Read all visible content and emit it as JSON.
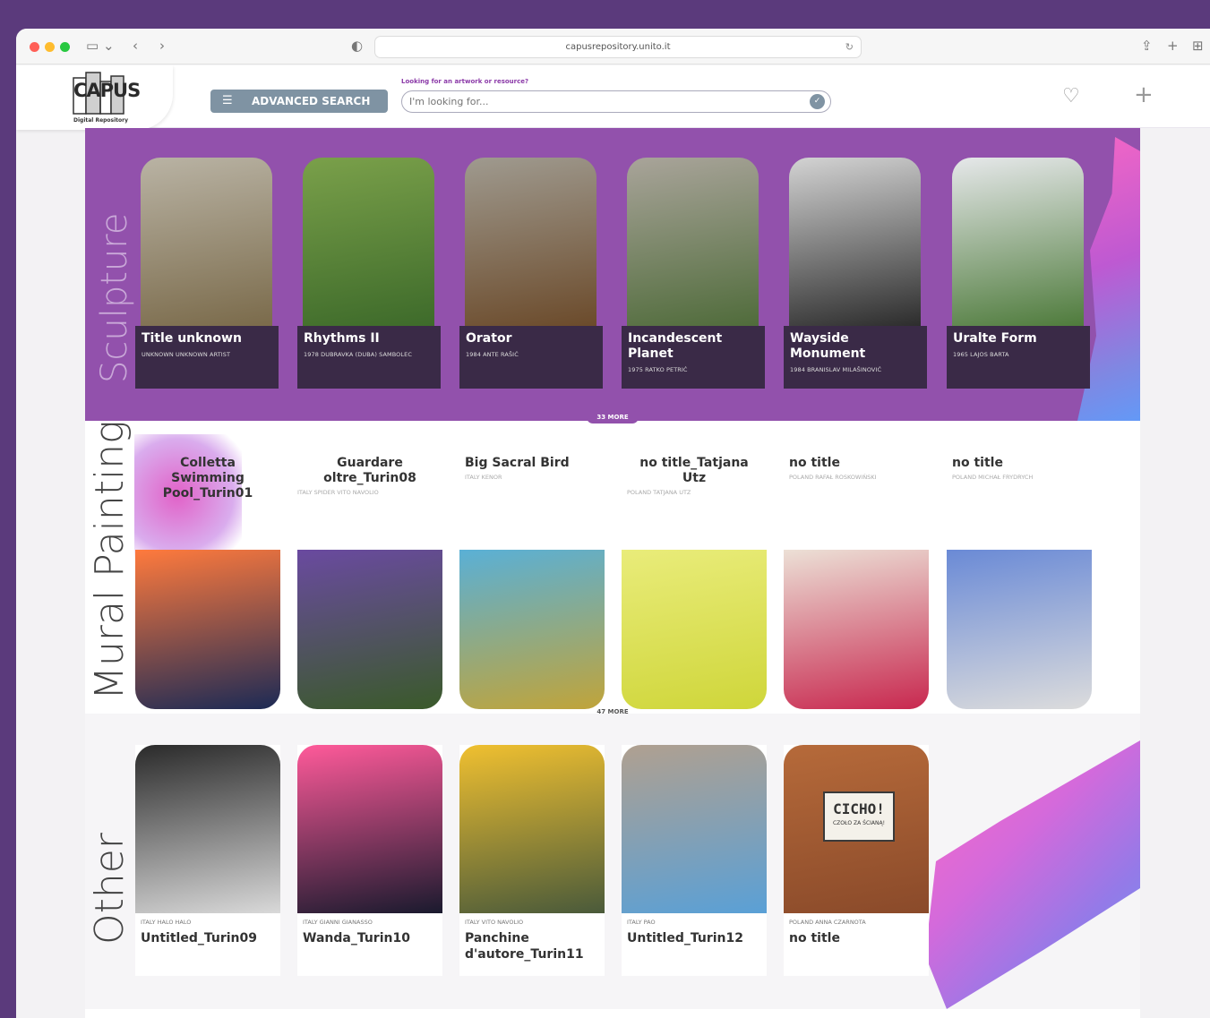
{
  "browser": {
    "url": "capusrepository.unito.it"
  },
  "header": {
    "logo_text": "CAPUS",
    "logo_sub": "Digital Repository",
    "advanced_search_label": "ADVANCED SEARCH",
    "search_hint": "Looking for an artwork or resource?",
    "search_placeholder": "I'm looking for..."
  },
  "sections": {
    "sculpture": {
      "label": "Sculpture",
      "more_label": "33 MORE",
      "cards": [
        {
          "title": "Title unknown",
          "meta": "UNKNOWN UNKNOWN ARTIST",
          "color1": "#7a6a4a",
          "color2": "#b9b3a4"
        },
        {
          "title": "Rhythms II",
          "meta": "1978 DUBRAVKA (DUBA) SAMBOLEC",
          "color1": "#3d6a2a",
          "color2": "#7aa04a"
        },
        {
          "title": "Orator",
          "meta": "1984 ANTE RAŠIĆ",
          "color1": "#6b4a2a",
          "color2": "#9f9a8f"
        },
        {
          "title": "Incandescent Planet",
          "meta": "1975 RATKO PETRIĆ",
          "color1": "#4f6b3a",
          "color2": "#a9a49a"
        },
        {
          "title": "Wayside Monument",
          "meta": "1984 BRANISLAV MILAŠINOVIĆ",
          "color1": "#2b2b2b",
          "color2": "#d3d3d3"
        },
        {
          "title": "Uralte Form",
          "meta": "1965 LAJOS BARTA",
          "color1": "#4d7a3a",
          "color2": "#e6e8ea"
        }
      ]
    },
    "mural": {
      "label": "Mural Painting",
      "more_label": "47 MORE",
      "cards": [
        {
          "title": "Colletta Swimming Pool_Turin01",
          "meta": "",
          "color1": "#1c2a55",
          "color2": "#ff7a3d"
        },
        {
          "title": "Guardare oltre_Turin08",
          "meta": "ITALY SPIDER VITO NAVOLIO",
          "color1": "#3a5a2a",
          "color2": "#6a4aa0"
        },
        {
          "title": "Big Sacral Bird",
          "meta": "ITALY KENOR",
          "color1": "#c0a43a",
          "color2": "#5ab0d6"
        },
        {
          "title": "no title_Tatjana Utz",
          "meta": "POLAND TATJANA UTZ",
          "color1": "#cfd63a",
          "color2": "#e9ec7a"
        },
        {
          "title": "no title",
          "meta": "POLAND RAFAŁ ROSKOWIŃSKI",
          "color1": "#c8284f",
          "color2": "#ece0d6"
        },
        {
          "title": "no title",
          "meta": "POLAND MICHAŁ FRYDRYCH",
          "color1": "#dcdcdc",
          "color2": "#6a8ad6"
        }
      ]
    },
    "other": {
      "label": "Other",
      "cards": [
        {
          "title": "Untitled_Turin09",
          "meta": "ITALY HALO HALO",
          "color1": "#d9d9d9",
          "color2": "#2a2a2a"
        },
        {
          "title": "Wanda_Turin10",
          "meta": "ITALY GIANNI GIANASSO",
          "color1": "#1a1a2e",
          "color2": "#ff5a9a"
        },
        {
          "title": "Panchine d'autore_Turin11",
          "meta": "ITALY VITO NAVOLIO",
          "color1": "#4a5a3a",
          "color2": "#f0c030"
        },
        {
          "title": "Untitled_Turin12",
          "meta": "ITALY PAO",
          "color1": "#5aa0d6",
          "color2": "#b0a090"
        },
        {
          "title": "no title",
          "meta": "POLAND ANNA CZARNOTA",
          "color1": "#8a4a2a",
          "color2": "#b66a3a"
        }
      ]
    }
  },
  "mural_img_text": {
    "sign_title": "CICHO!",
    "sign_sub": "CZOŁO ZA ŚCIANĄ!"
  }
}
